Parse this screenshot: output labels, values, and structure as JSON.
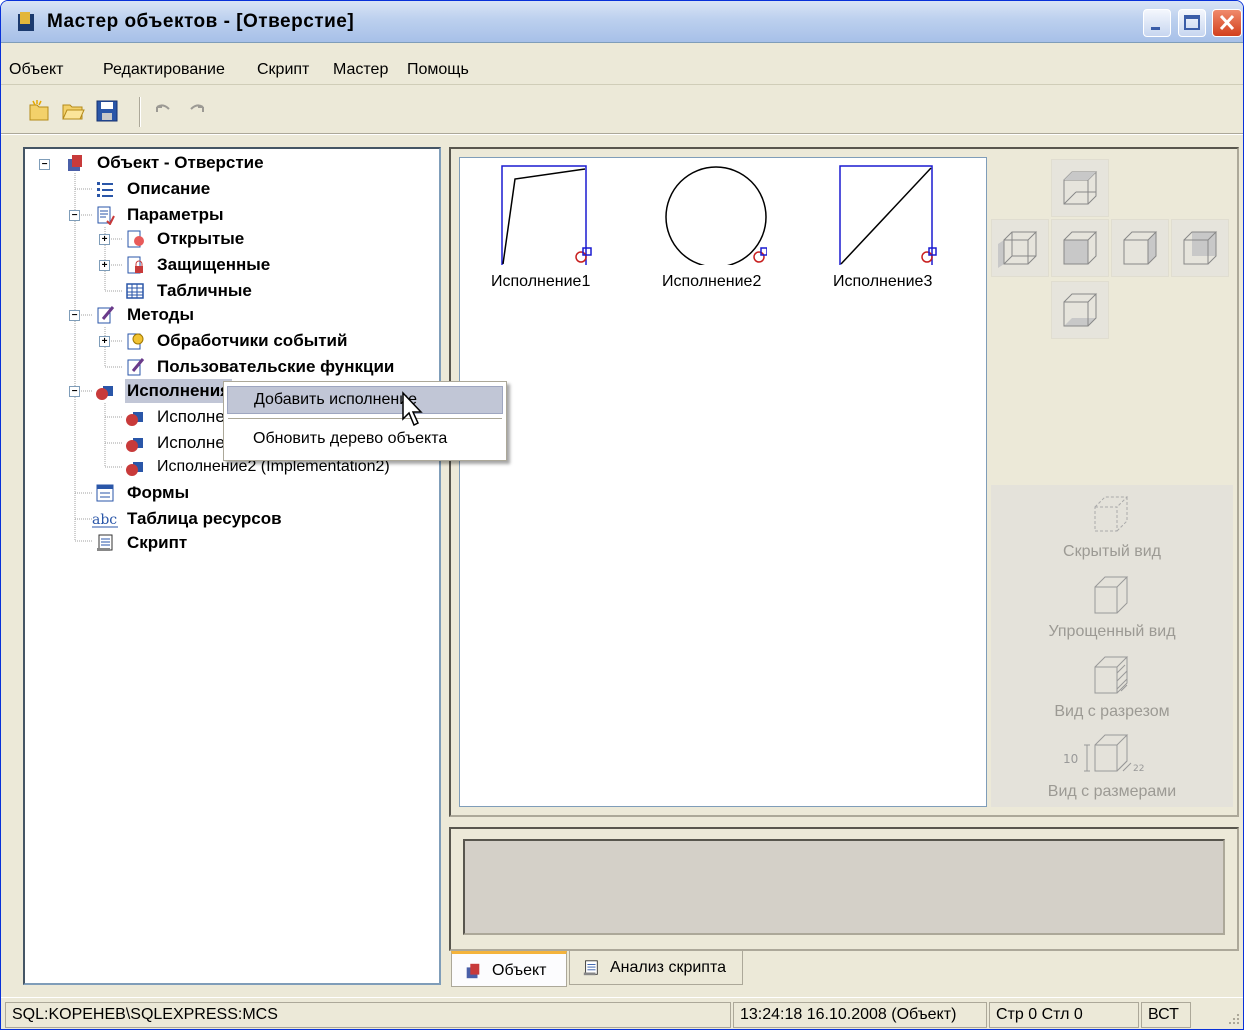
{
  "window": {
    "title": "Мастер объектов - [Отверстие]",
    "app_icon": "app-icon",
    "controls": [
      "minimize-icon",
      "maximize-icon",
      "close-icon"
    ]
  },
  "menubar": {
    "items": [
      "Объект",
      "Редактирование",
      "Скрипт",
      "Мастер",
      "Помощь"
    ]
  },
  "toolbar": {
    "icons": [
      "new-icon",
      "open-folder-icon",
      "save-icon",
      "undo-icon",
      "redo-icon"
    ]
  },
  "tree": {
    "root": "Объект - Отверстие",
    "description": "Описание",
    "parameters": "Параметры",
    "open": "Открытые",
    "protected": "Защищенные",
    "tabular": "Табличные",
    "methods": "Методы",
    "event_handlers": "Обработчики событий",
    "user_functions": "Пользовательские функции",
    "implementations": "Исполнения",
    "impl_0": "Исполнение0 (Implementation0)",
    "impl_1": "Исполнение1 (Implementation1)",
    "impl_2": "Исполнение2 (Implementation2)",
    "forms": "Формы",
    "resources": "Таблица ресурсов",
    "script": "Скрипт"
  },
  "context_menu": {
    "add": "Добавить исполнение",
    "refresh": "Обновить дерево объекта"
  },
  "preview": {
    "thumbnails": [
      "Исполнение1",
      "Исполнение2",
      "Исполнение3"
    ]
  },
  "views": {
    "hidden": "Скрытый вид",
    "simplified": "Упрощенный вид",
    "section": "Вид с разрезом",
    "dimensions": "Вид с размерами"
  },
  "tabs": {
    "object": "Объект",
    "script_analysis": "Анализ скрипта"
  },
  "statusbar": {
    "connection": "SQL:KOPEHEB\\SQLEXPRESS:MCS",
    "time": "13:24:18  16.10.2008  (Объект)",
    "position": "Стр 0 Стл 0",
    "mode": "ВСТ"
  },
  "colors": {
    "accent": "#0831d9",
    "selection": "#c1c6d6",
    "tab_active": "#f4b33b"
  }
}
